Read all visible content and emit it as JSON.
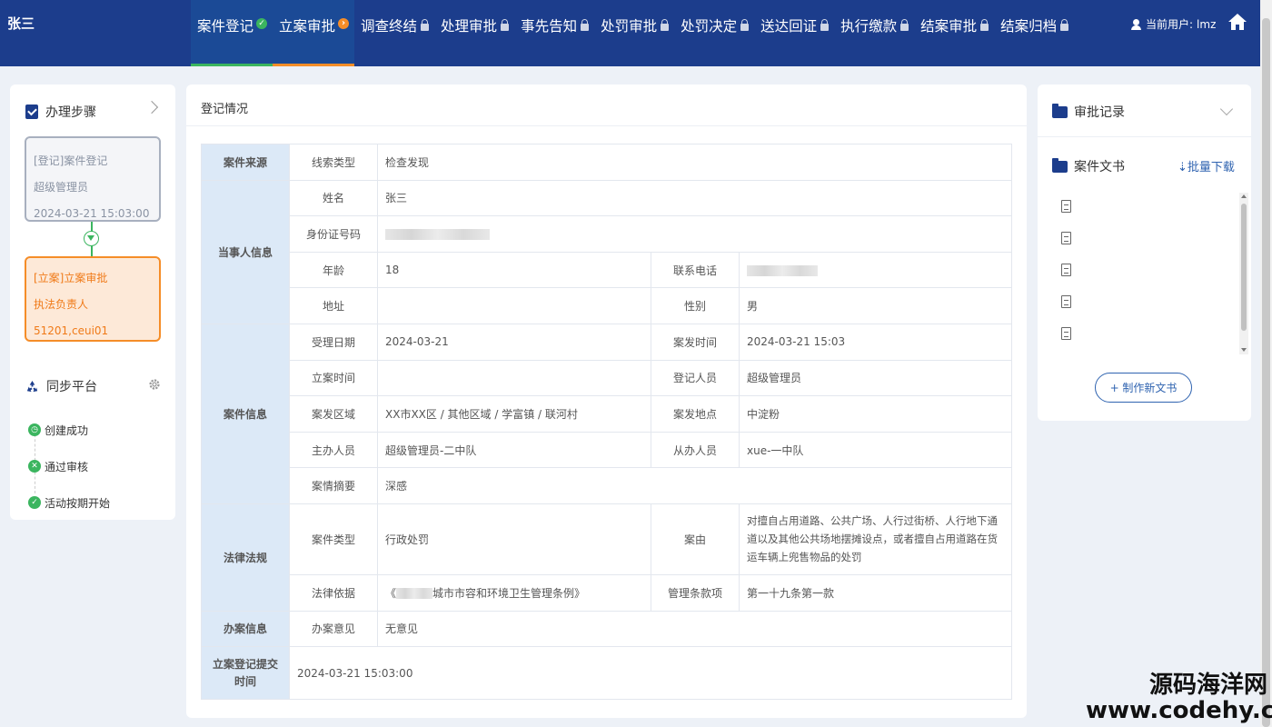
{
  "header": {
    "brand": "张三",
    "nav": [
      {
        "label": "案件登记",
        "state": "done"
      },
      {
        "label": "立案审批",
        "state": "active"
      },
      {
        "label": "调查终结",
        "state": "locked"
      },
      {
        "label": "处理审批",
        "state": "locked"
      },
      {
        "label": "事先告知",
        "state": "locked"
      },
      {
        "label": "处罚审批",
        "state": "locked"
      },
      {
        "label": "处罚决定",
        "state": "locked"
      },
      {
        "label": "送达回证",
        "state": "locked"
      },
      {
        "label": "执行缴款",
        "state": "locked"
      },
      {
        "label": "结案审批",
        "state": "locked"
      },
      {
        "label": "结案归档",
        "state": "locked"
      }
    ],
    "user_label": "当前用户:",
    "user_name": "lmz",
    "icons": [
      "check-circle-icon",
      "arrow-circle-icon",
      "lock-icon",
      "user-icon",
      "home-icon"
    ]
  },
  "steps_panel": {
    "title": "办理步骤",
    "step1": {
      "title": "[登记]案件登记",
      "person": "超级管理员",
      "time": "2024-03-21 15:03:00"
    },
    "step2": {
      "title": "[立案]立案审批",
      "person": "执法负责人51201,ceui01"
    },
    "sync_title": "同步平台",
    "sync_items": [
      "创建成功",
      "通过审核",
      "活动按期开始"
    ]
  },
  "main": {
    "title": "登记情况",
    "sections": {
      "source": "案件来源",
      "party": "当事人信息",
      "case": "案件信息",
      "law": "法律法规",
      "handle": "办案信息",
      "submit": "立案登记提交时间"
    },
    "labels": {
      "clue_type": "线索类型",
      "name": "姓名",
      "id_no": "身份证号码",
      "age": "年龄",
      "phone": "联系电话",
      "address": "地址",
      "gender": "性别",
      "accept_date": "受理日期",
      "occur_time": "案发时间",
      "file_time": "立案时间",
      "registrar": "登记人员",
      "area": "案发区域",
      "location": "案发地点",
      "main_officer": "主办人员",
      "assist_officer": "从办人员",
      "summary": "案情摘要",
      "case_type": "案件类型",
      "cause": "案由",
      "legal_basis": "法律依据",
      "clause": "管理条款项",
      "opinion": "办案意见"
    },
    "values": {
      "clue_type": "检查发现",
      "name": "张三",
      "age": "18",
      "gender": "男",
      "accept_date": "2024-03-21",
      "occur_time": "2024-03-21 15:03",
      "registrar": "超级管理员",
      "area": "XX市XX区 / 其他区域 / 学富镇 / 联河村",
      "location": "中淀粉",
      "main_officer": "超级管理员-二中队",
      "assist_officer": "xue-一中队",
      "summary": "深感",
      "case_type": "行政处罚",
      "cause": "对擅自占用道路、公共广场、人行过街桥、人行地下通道以及其他公共场地摆摊设点，或者擅自占用道路在货运车辆上兜售物品的处罚",
      "legal_basis_pre": "《",
      "legal_basis_post": "城市市容和环境卫生管理条例》",
      "clause": "第一十九条第一款",
      "opinion": "无意见",
      "submit_time": "2024-03-21 15:03:00"
    }
  },
  "right_panel": {
    "approval_title": "审批记录",
    "docs_title": "案件文书",
    "batch_download": "⇣批量下载",
    "new_doc": "+ 制作新文书"
  },
  "watermark": {
    "line1": "源码海洋网",
    "line2": "www.codehy.com"
  }
}
